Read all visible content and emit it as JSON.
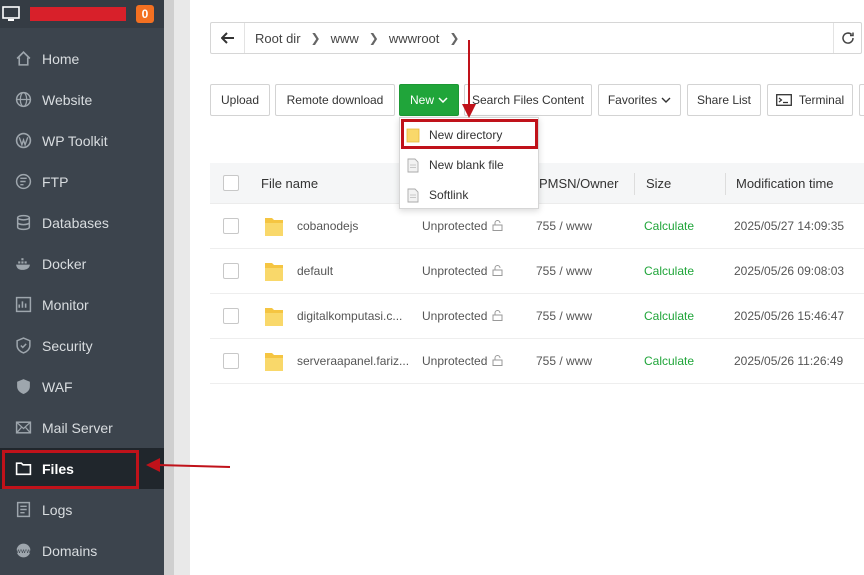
{
  "sidebar": {
    "badge": "0",
    "items": [
      {
        "label": "Home",
        "icon": "home-icon"
      },
      {
        "label": "Website",
        "icon": "globe-icon"
      },
      {
        "label": "WP Toolkit",
        "icon": "wordpress-icon"
      },
      {
        "label": "FTP",
        "icon": "ftp-icon"
      },
      {
        "label": "Databases",
        "icon": "database-icon"
      },
      {
        "label": "Docker",
        "icon": "docker-icon"
      },
      {
        "label": "Monitor",
        "icon": "monitor-icon"
      },
      {
        "label": "Security",
        "icon": "shield-icon"
      },
      {
        "label": "WAF",
        "icon": "waf-shield-icon"
      },
      {
        "label": "Mail Server",
        "icon": "mail-icon"
      },
      {
        "label": "Files",
        "icon": "folder-icon"
      },
      {
        "label": "Logs",
        "icon": "logs-icon"
      },
      {
        "label": "Domains",
        "icon": "domains-icon"
      }
    ],
    "active": "Files"
  },
  "path": {
    "crumbs": [
      "Root dir",
      "www",
      "wwwroot"
    ]
  },
  "toolbar": {
    "upload": "Upload",
    "remote_download": "Remote download",
    "new": "New",
    "search": "Search Files Content",
    "favorites": "Favorites",
    "share": "Share List",
    "terminal": "Terminal"
  },
  "new_menu": {
    "items": [
      "New directory",
      "New blank file",
      "Softlink"
    ]
  },
  "table": {
    "headers": {
      "name": "File name",
      "perm": "PMSN/Owner",
      "size": "Size",
      "mtime": "Modification time"
    },
    "rows": [
      {
        "name": "cobanodejs",
        "protect": "Unprotected",
        "perm": "755 / www",
        "size": "Calculate",
        "mtime": "2025/05/27 14:09:35"
      },
      {
        "name": "default",
        "protect": "Unprotected",
        "perm": "755 / www",
        "size": "Calculate",
        "mtime": "2025/05/26 09:08:03"
      },
      {
        "name": "digitalkomputasi.c...",
        "protect": "Unprotected",
        "perm": "755 / www",
        "size": "Calculate",
        "mtime": "2025/05/26 15:46:47"
      },
      {
        "name": "serveraapanel.fariz...",
        "protect": "Unprotected",
        "perm": "755 / www",
        "size": "Calculate",
        "mtime": "2025/05/26 11:26:49"
      }
    ]
  },
  "colors": {
    "sidebar_bg": "#3c444d",
    "accent_green": "#20a53a",
    "badge_orange": "#f37021",
    "annotation_red": "#c0121a"
  }
}
